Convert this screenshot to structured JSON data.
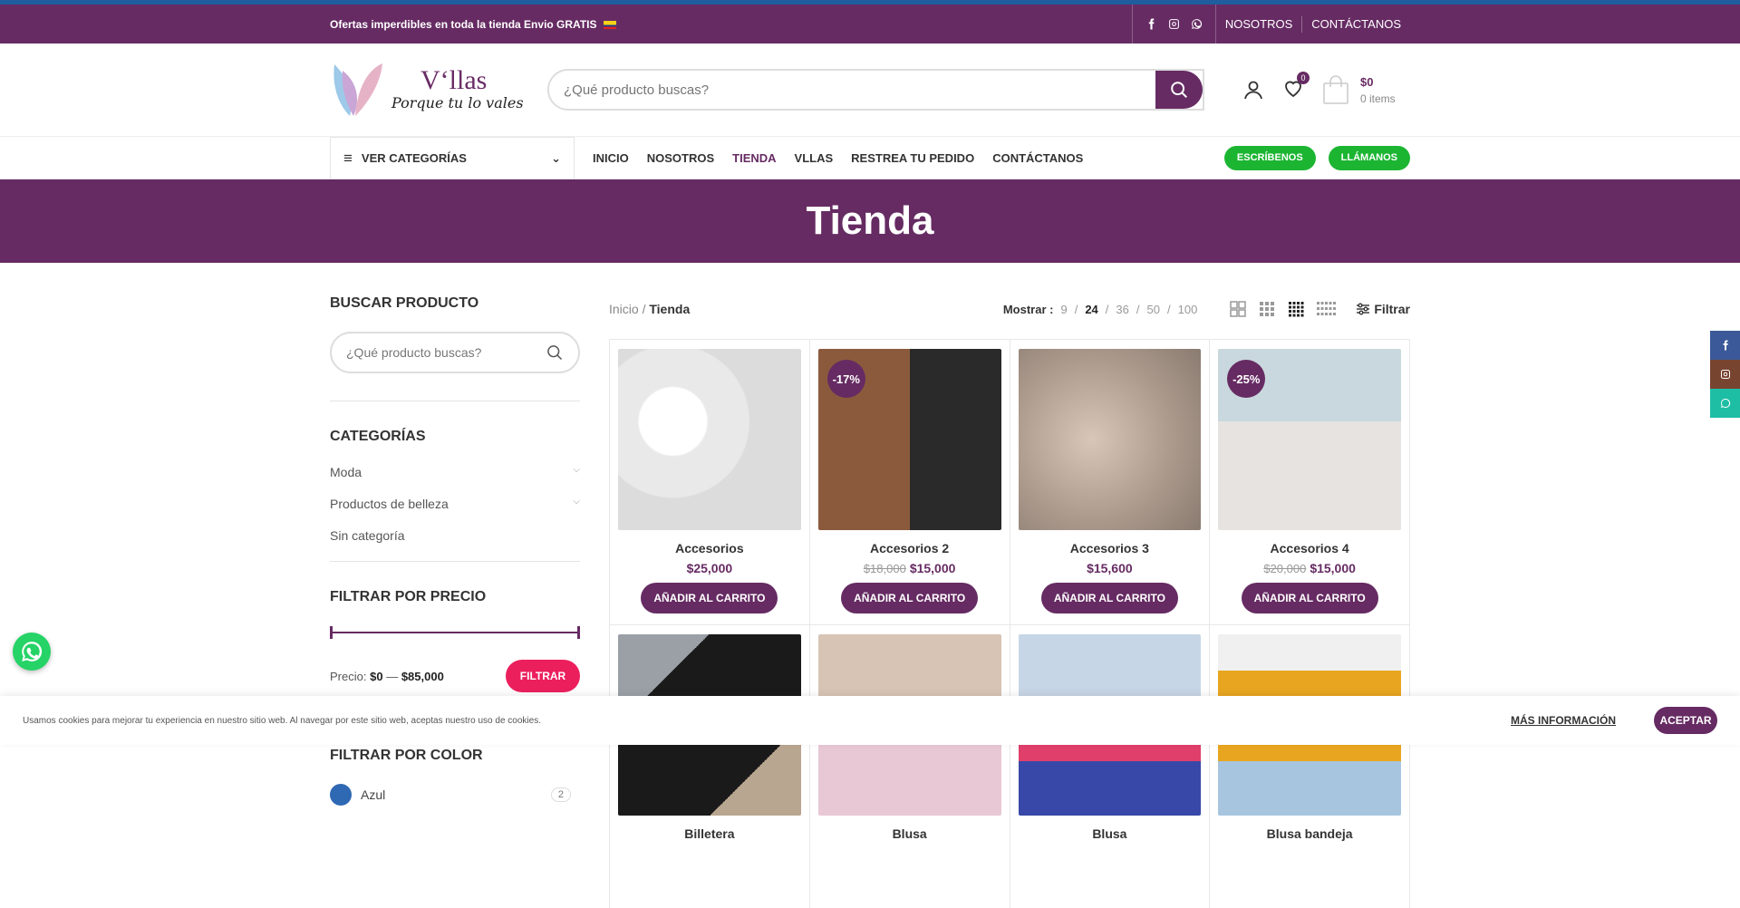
{
  "topbar": {
    "promo": "Ofertas imperdibles en toda la tienda Envio GRATIS",
    "links": [
      "NOSOTROS",
      "CONTÁCTANOS"
    ]
  },
  "header": {
    "brand": "V‘llas",
    "tagline": "Porque tu lo vales",
    "search_placeholder": "¿Qué producto buscas?",
    "wishlist_count": "0",
    "cart_amount": "$0",
    "cart_items": "0 items"
  },
  "nav": {
    "categories_label": "VER CATEGORÍAS",
    "menu": [
      "INICIO",
      "NOSOTROS",
      "TIENDA",
      "VLLAS",
      "RESTREA TU PEDIDO",
      "CONTÁCTANOS"
    ],
    "write_label": "ESCRÍBENOS",
    "call_label": "LLÁMANOS"
  },
  "page_title": "Tienda",
  "sidebar": {
    "search_title": "BUSCAR PRODUCTO",
    "search_placeholder": "¿Qué producto buscas?",
    "categories_title": "CATEGORÍAS",
    "categories": [
      "Moda",
      "Productos de belleza",
      "Sin categoría"
    ],
    "price_title": "FILTRAR POR PRECIO",
    "price_label": "Precio:",
    "price_min": "$0",
    "price_sep": "—",
    "price_max": "$85,000",
    "filter_button": "FILTRAR",
    "color_title": "FILTRAR POR COLOR",
    "colors": [
      {
        "name": "Azul",
        "count": "2",
        "hex": "#2f68b3"
      }
    ]
  },
  "toolbar": {
    "breadcrumb_home": "Inicio",
    "breadcrumb_sep": "/",
    "breadcrumb_current": "Tienda",
    "show_label": "Mostrar :",
    "per_page": [
      "9",
      "24",
      "36",
      "50",
      "100"
    ],
    "per_page_selected": "24",
    "filter_label": "Filtrar"
  },
  "products": [
    {
      "name": "Accesorios",
      "price": "$25,000",
      "old_price": "",
      "sale": "",
      "button": "AÑADIR AL CARRITO"
    },
    {
      "name": "Accesorios 2",
      "price": "$15,000",
      "old_price": "$18,000",
      "sale": "-17%",
      "button": "AÑADIR AL CARRITO"
    },
    {
      "name": "Accesorios 3",
      "price": "$15,600",
      "old_price": "",
      "sale": "",
      "button": "AÑADIR AL CARRITO"
    },
    {
      "name": "Accesorios 4",
      "price": "$15,000",
      "old_price": "$20,000",
      "sale": "-25%",
      "button": "AÑADIR AL CARRITO"
    },
    {
      "name": "Billetera",
      "price": "",
      "old_price": "",
      "sale": "",
      "button": ""
    },
    {
      "name": "Blusa",
      "price": "",
      "old_price": "",
      "sale": "",
      "button": ""
    },
    {
      "name": "Blusa",
      "price": "",
      "old_price": "",
      "sale": "",
      "button": ""
    },
    {
      "name": "Blusa bandeja",
      "price": "",
      "old_price": "",
      "sale": "",
      "button": ""
    }
  ],
  "cookie": {
    "text": "Usamos cookies para mejorar tu experiencia en nuestro sitio web. Al navegar por este sitio web, aceptas nuestro uso de cookies.",
    "more": "MÁS INFORMACIÓN",
    "accept": "ACEPTAR"
  },
  "colors": {
    "brand": "#662b63",
    "green": "#1cb532",
    "pink": "#ec1f5d"
  }
}
